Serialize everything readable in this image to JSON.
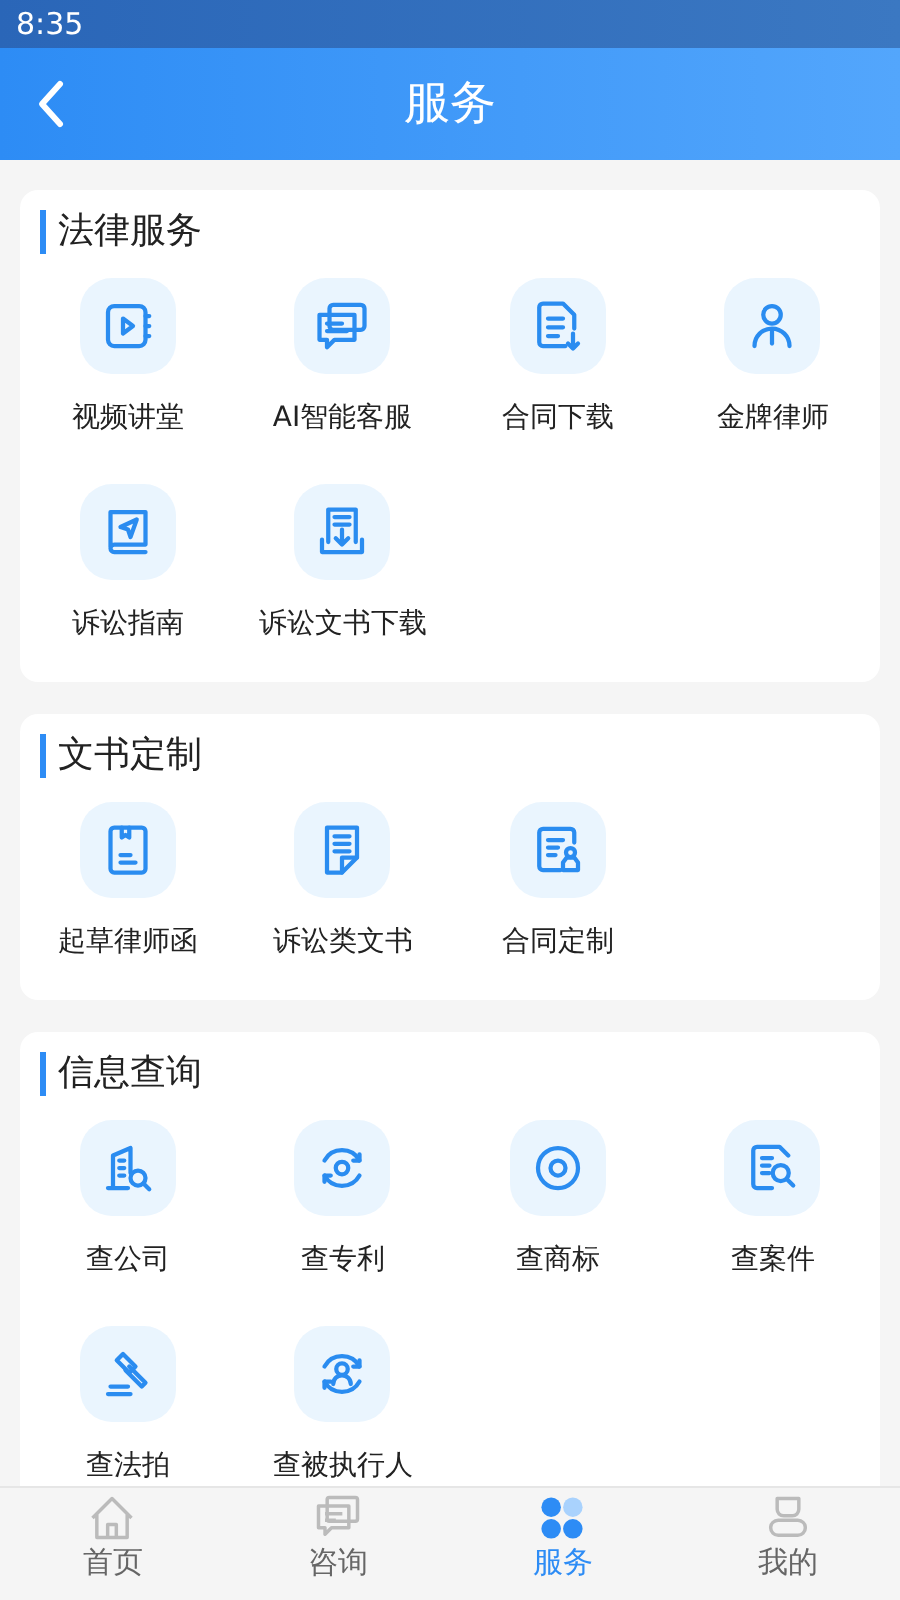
{
  "status_bar": {
    "time": "8:35"
  },
  "header": {
    "title": "服务"
  },
  "sections": [
    {
      "title": "法律服务",
      "items": [
        {
          "label": "视频讲堂"
        },
        {
          "label": "AI智能客服"
        },
        {
          "label": "合同下载"
        },
        {
          "label": "金牌律师"
        },
        {
          "label": "诉讼指南"
        },
        {
          "label": "诉讼文书下载"
        }
      ]
    },
    {
      "title": "文书定制",
      "items": [
        {
          "label": "起草律师函"
        },
        {
          "label": "诉讼类文书"
        },
        {
          "label": "合同定制"
        }
      ]
    },
    {
      "title": "信息查询",
      "items": [
        {
          "label": "查公司"
        },
        {
          "label": "查专利"
        },
        {
          "label": "查商标"
        },
        {
          "label": "查案件"
        },
        {
          "label": "查法拍"
        },
        {
          "label": "查被执行人"
        }
      ]
    }
  ],
  "tab_bar": [
    {
      "label": "首页",
      "selected": false
    },
    {
      "label": "咨询",
      "selected": false
    },
    {
      "label": "服务",
      "selected": true
    },
    {
      "label": "我的",
      "selected": false
    }
  ]
}
